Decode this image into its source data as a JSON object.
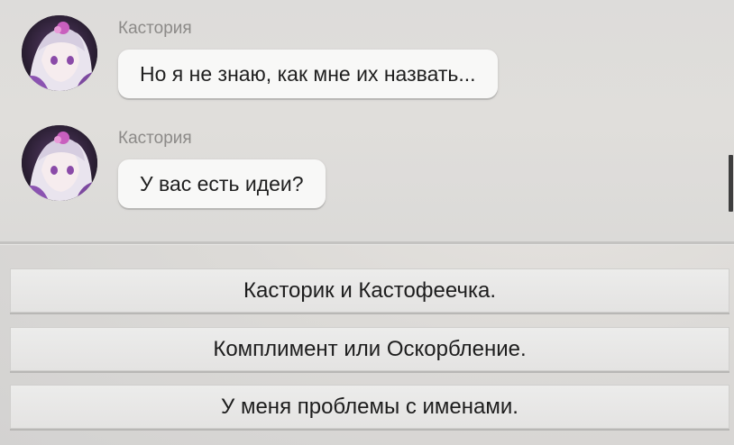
{
  "chat": {
    "messages": [
      {
        "sender": "Кастория",
        "text": "Но я не знаю, как мне их назвать...",
        "avatar_icon": "character-portrait-icon"
      },
      {
        "sender": "Кастория",
        "text": "У вас есть идеи?",
        "avatar_icon": "character-portrait-icon"
      }
    ]
  },
  "options": [
    {
      "label": "Касторик и Кастофеечка."
    },
    {
      "label": "Комплимент или Оскорбление."
    },
    {
      "label": "У меня проблемы с именами."
    }
  ],
  "colors": {
    "bubble": "#f8f8f7",
    "sender": "#8c8a88",
    "background": "#dddcda",
    "scrollbar": "#3e3e3e"
  }
}
